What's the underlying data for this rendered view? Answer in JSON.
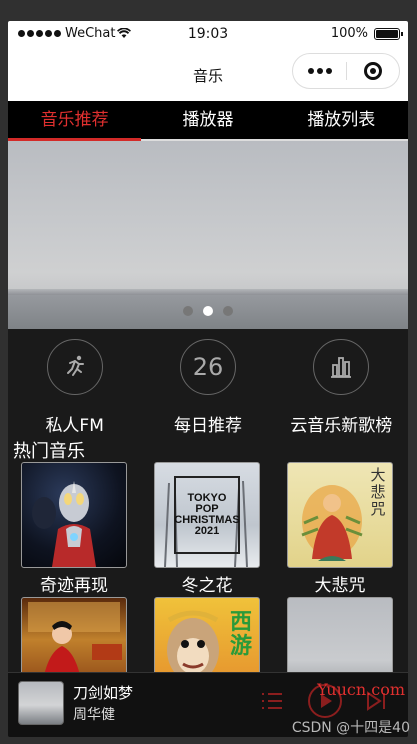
{
  "status_bar": {
    "carrier": "WeChat",
    "time": "19:03",
    "battery": "100%"
  },
  "nav": {
    "title": "音乐"
  },
  "tabs": [
    {
      "label": "音乐推荐",
      "active": true
    },
    {
      "label": "播放器",
      "active": false
    },
    {
      "label": "播放列表",
      "active": false
    }
  ],
  "banner": {
    "slide_count": 3,
    "active_index": 1
  },
  "quick_nav": [
    {
      "label": "私人FM",
      "icon": "running-person-icon"
    },
    {
      "label": "每日推荐",
      "icon": "calendar-26-icon",
      "badge": "26"
    },
    {
      "label": "云音乐新歌榜",
      "icon": "bar-chart-icon"
    }
  ],
  "hot_music": {
    "title": "热门音乐",
    "items": [
      {
        "name": "奇迹再现",
        "cover": "ultraman-cover"
      },
      {
        "name": "冬之花",
        "cover": "tokyo-pop-christmas-cover",
        "cover_text": [
          "TOKYO",
          "POP",
          "CHRISTMAS",
          "2021"
        ]
      },
      {
        "name": "大悲咒",
        "cover": "buddha-cover",
        "cover_text": [
          "大",
          "悲",
          "咒"
        ]
      },
      {
        "name": "",
        "cover": "red-dress-singer-cover"
      },
      {
        "name": "",
        "cover": "monkey-king-cover",
        "cover_text": [
          "西",
          "游"
        ]
      },
      {
        "name": "",
        "cover": "sea-horizon-cover"
      }
    ]
  },
  "player": {
    "song": "刀剑如梦",
    "artist": "周华健"
  },
  "watermarks": {
    "site": "Yuucn.com",
    "credit": "CSDN @十四是40"
  },
  "colors": {
    "accent": "#e0302f",
    "background": "#1a1a1a"
  }
}
